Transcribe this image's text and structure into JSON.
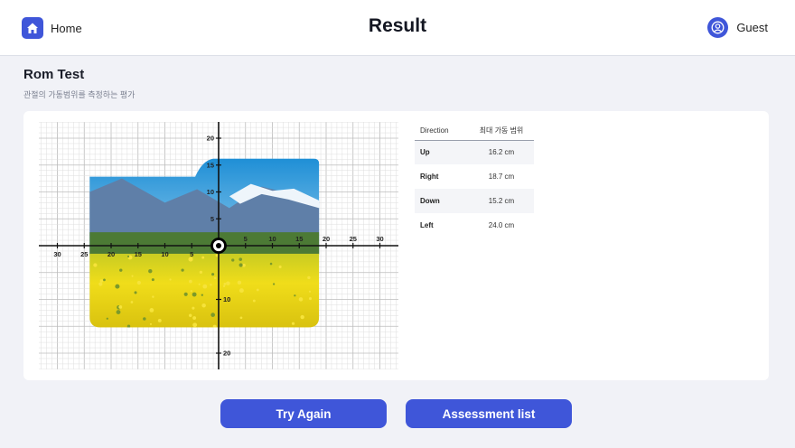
{
  "header": {
    "home_label": "Home",
    "title": "Result",
    "user_label": "Guest"
  },
  "assessment": {
    "title": "Rom Test",
    "subtitle": "관절의 가동범위를 측정하는 평가"
  },
  "table": {
    "columns": [
      "Direction",
      "최대 가동 범위"
    ],
    "rows": [
      {
        "direction": "Up",
        "value": "16.2 cm"
      },
      {
        "direction": "Right",
        "value": "18.7 cm"
      },
      {
        "direction": "Down",
        "value": "15.2 cm"
      },
      {
        "direction": "Left",
        "value": "24.0 cm"
      }
    ]
  },
  "chart_data": {
    "type": "scatter",
    "xlim": [
      -33,
      33
    ],
    "ylim": [
      -23,
      23
    ],
    "grid": true,
    "x_tick_labels": [
      "30",
      "25",
      "20",
      "15",
      "10",
      "5",
      "5",
      "10",
      "15",
      "20",
      "25",
      "30"
    ],
    "x_tick_values": [
      -30,
      -25,
      -20,
      -15,
      -10,
      -5,
      5,
      10,
      15,
      20,
      25,
      30
    ],
    "y_tick_labels": [
      "20",
      "15",
      "10",
      "5",
      "10",
      "20"
    ],
    "y_tick_values": [
      20,
      15,
      10,
      5,
      -10,
      -20
    ],
    "image_extent": {
      "x": [
        -24.0,
        18.7
      ],
      "y": [
        -15.2,
        16.2
      ]
    },
    "origin": {
      "x": 0,
      "y": 0
    },
    "colors": {
      "sky": "#2f9ddc",
      "mountain": "#5f7fa8",
      "field": "#e6d61a",
      "marker": "#000000"
    }
  },
  "buttons": {
    "try_again": "Try Again",
    "assessment_list": "Assessment list"
  },
  "colors": {
    "accent": "#3f56d9",
    "background": "#f1f2f7"
  }
}
